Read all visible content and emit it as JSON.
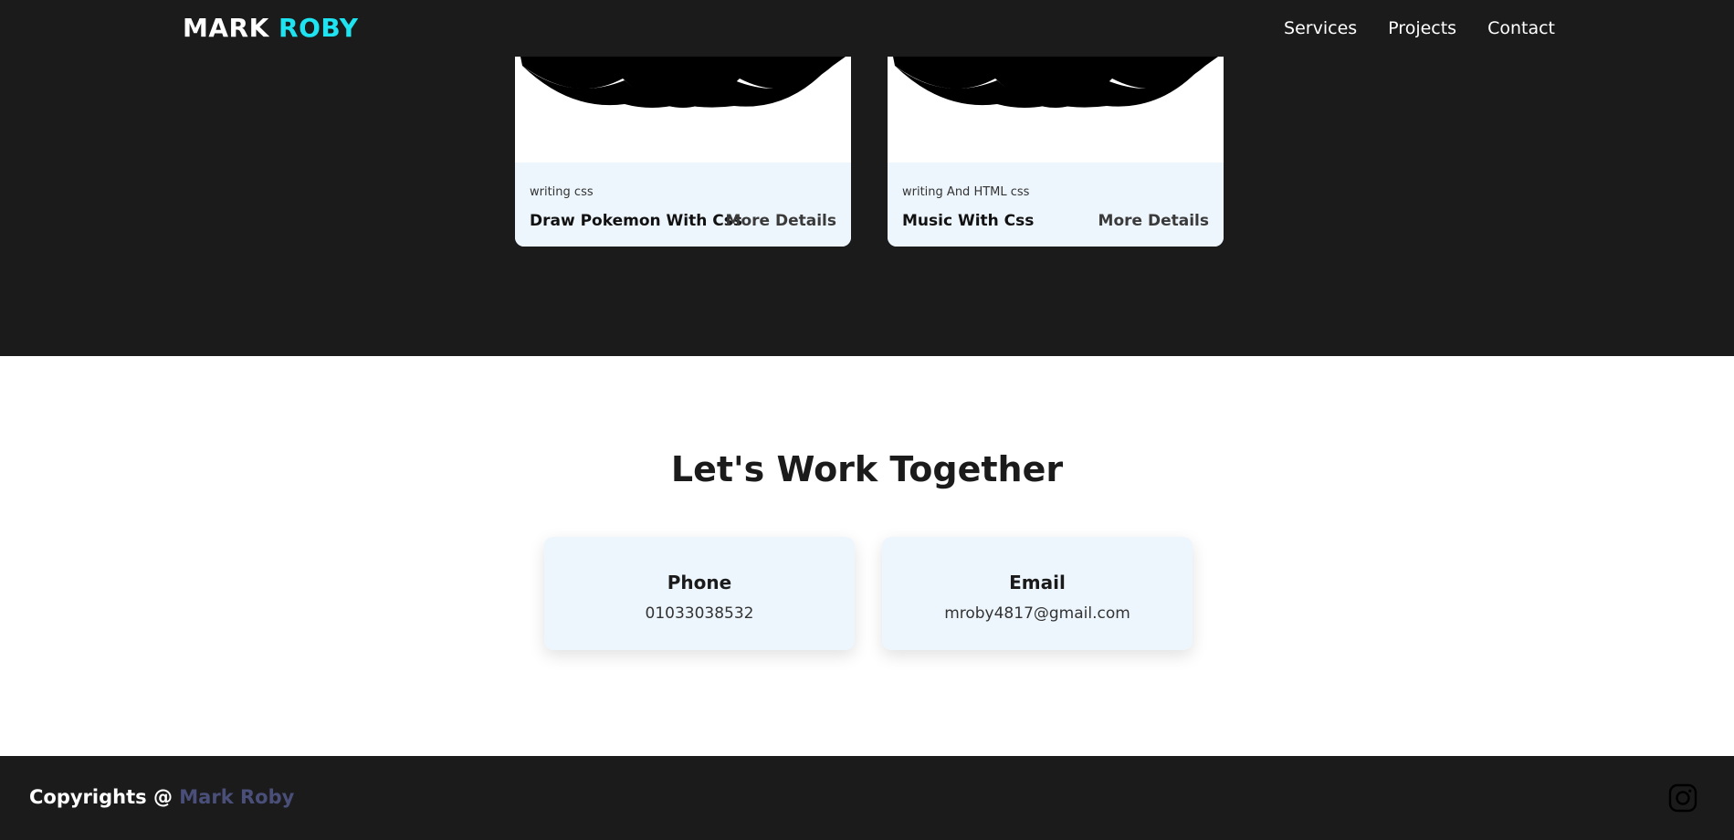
{
  "brand": {
    "first": "MARK",
    "second": "ROBY"
  },
  "nav": [
    {
      "label": "Services"
    },
    {
      "label": "Projects"
    },
    {
      "label": "Contact"
    }
  ],
  "projects": [
    {
      "tag": "writing css",
      "title": "Draw Pokemon With Css",
      "more": "More Details"
    },
    {
      "tag": "writing And HTML css",
      "title": "Music With Css",
      "more": "More Details"
    }
  ],
  "contact": {
    "heading": "Let's Work Together",
    "phone_label": "Phone",
    "phone_value": "01033038532",
    "email_label": "Email",
    "email_value": "mroby4817@gmail.com"
  },
  "footer": {
    "copyright_prefix": "Copyrights @",
    "owner": "Mark Roby",
    "social_icon": "instagram-icon"
  },
  "colors": {
    "dark_bg": "#1b1b1b",
    "accent": "#1ee3f0",
    "card_meta_bg": "#eef6fd",
    "owner_color": "#4a4f7a"
  }
}
